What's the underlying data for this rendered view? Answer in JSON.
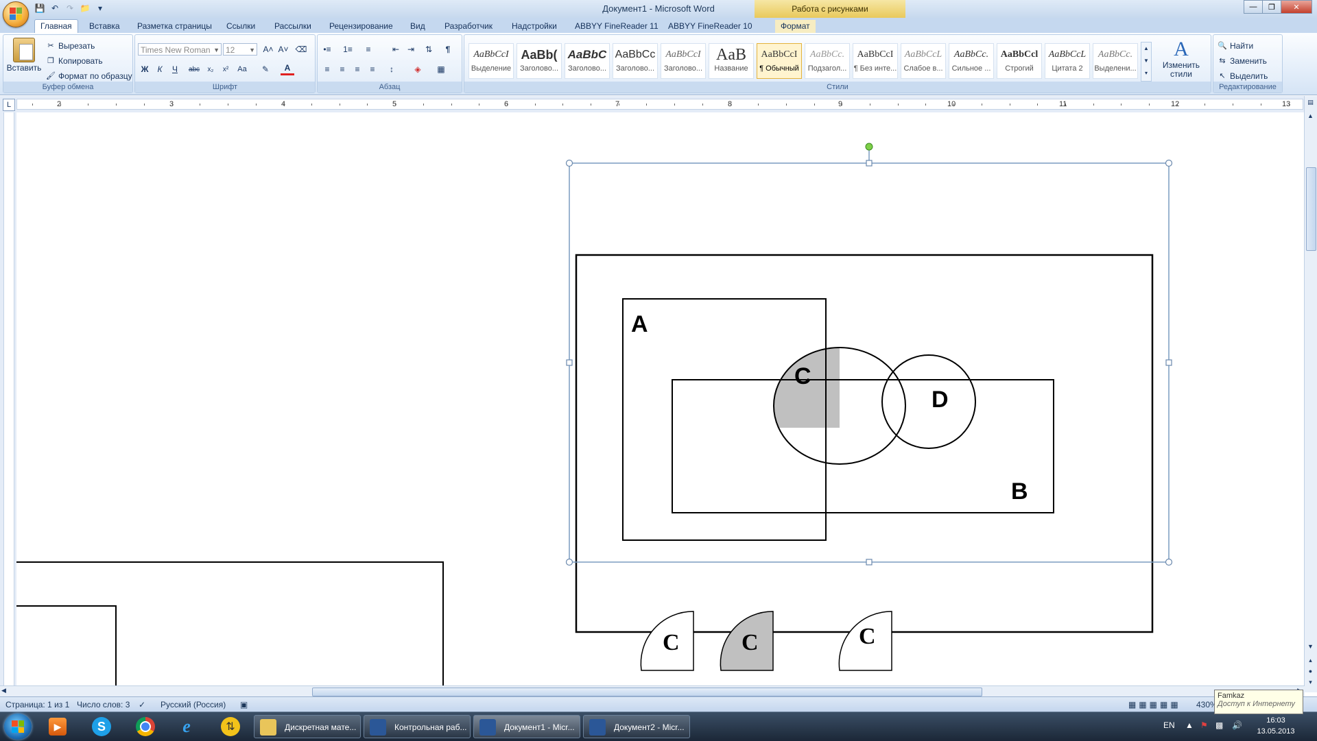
{
  "window": {
    "title": "Документ1 - Microsoft Word",
    "contextual_tab_title": "Работа с рисунками"
  },
  "tabs": [
    {
      "label": "Главная"
    },
    {
      "label": "Вставка"
    },
    {
      "label": "Разметка страницы"
    },
    {
      "label": "Ссылки"
    },
    {
      "label": "Рассылки"
    },
    {
      "label": "Рецензирование"
    },
    {
      "label": "Вид"
    },
    {
      "label": "Разработчик"
    },
    {
      "label": "Надстройки"
    },
    {
      "label": "ABBYY FineReader 11"
    },
    {
      "label": "ABBYY FineReader 10"
    },
    {
      "label": "Формат"
    }
  ],
  "ribbon": {
    "clipboard": {
      "paste_label": "Вставить",
      "cut_label": "Вырезать",
      "copy_label": "Копировать",
      "format_painter_label": "Формат по образцу",
      "group_label": "Буфер обмена"
    },
    "font": {
      "font_name": "Times New Roman",
      "font_size": "12",
      "group_label": "Шрифт"
    },
    "paragraph": {
      "group_label": "Абзац"
    },
    "styles": {
      "group_label": "Стили",
      "items": [
        {
          "sample": "AaBbCcI",
          "name": "Выделение"
        },
        {
          "sample": "AaBb(",
          "name": "Заголово..."
        },
        {
          "sample": "AaBbC",
          "name": "Заголово..."
        },
        {
          "sample": "AaBbCc",
          "name": "Заголово..."
        },
        {
          "sample": "AaBbCcI",
          "name": "Заголово..."
        },
        {
          "sample": "AaB",
          "name": "Название"
        },
        {
          "sample": "AaBbCcI",
          "name": "¶ Обычный"
        },
        {
          "sample": "AaBbCc.",
          "name": "Подзагол..."
        },
        {
          "sample": "AaBbCcI",
          "name": "¶ Без инте..."
        },
        {
          "sample": "AaBbCcL",
          "name": "Слабое в..."
        },
        {
          "sample": "AaBbCc.",
          "name": "Сильное ..."
        },
        {
          "sample": "AaBbCcl",
          "name": "Строгий"
        },
        {
          "sample": "AaBbCcL",
          "name": "Цитата 2"
        },
        {
          "sample": "AaBbCc.",
          "name": "Выделени..."
        }
      ],
      "change_styles_label": "Изменить стили"
    },
    "editing": {
      "group_label": "Редактирование",
      "find_label": "Найти",
      "replace_label": "Заменить",
      "select_label": "Выделить"
    }
  },
  "ruler": {
    "numbers": [
      "2",
      "3",
      "4",
      "5",
      "6",
      "7",
      "8",
      "9",
      "10",
      "11",
      "12",
      "13"
    ]
  },
  "drawing": {
    "label_a": "A",
    "label_b": "B",
    "label_c": "C",
    "label_d": "D",
    "small_shapes": [
      {
        "label": "C",
        "filled": false
      },
      {
        "label": "C",
        "filled": true
      },
      {
        "label": "C",
        "filled": false
      }
    ]
  },
  "status_bar": {
    "page": "Страница: 1 из 1",
    "words": "Число слов: 3",
    "language": "Русский (Россия)",
    "zoom": "430%"
  },
  "tooltip": {
    "title": "Famkaz",
    "subtitle": "Доступ к Интернету"
  },
  "taskbar": {
    "tasks": [
      {
        "label": "Дискретная мате..."
      },
      {
        "label": "Контрольная раб..."
      },
      {
        "label": "Документ1 - Micr..."
      },
      {
        "label": "Документ2 - Micr..."
      }
    ],
    "language": "EN",
    "time": "16:03",
    "date": "13.05.2013"
  },
  "colors": {
    "shaded_region": "#c0c0c0",
    "selection_frame": "#7a9cc0",
    "rotate_handle": "#7ed048"
  }
}
